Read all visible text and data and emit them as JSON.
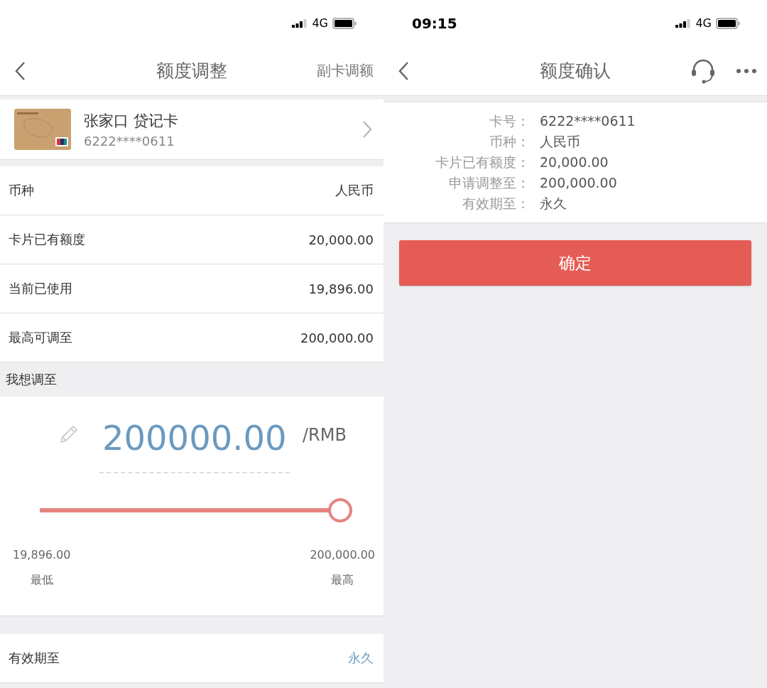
{
  "left": {
    "status": {
      "network": "4G"
    },
    "nav": {
      "title": "额度调整",
      "action": "副卡调额"
    },
    "card": {
      "name": "张家口 贷记卡",
      "number": "6222****0611"
    },
    "rows": [
      {
        "label": "币种",
        "value": "人民币"
      },
      {
        "label": "卡片已有额度",
        "value": "20,000.00"
      },
      {
        "label": "当前已使用",
        "value": "19,896.00"
      },
      {
        "label": "最高可调至",
        "value": "200,000.00"
      }
    ],
    "section_title": "我想调至",
    "amount": {
      "value": "200000.00",
      "unit": "/RMB"
    },
    "slider": {
      "level": 1,
      "min_value": "19,896.00",
      "min_label": "最低",
      "max_value": "200,000.00",
      "max_label": "最高"
    },
    "validity": {
      "label": "有效期至",
      "value": "永久"
    }
  },
  "right": {
    "status": {
      "time": "09:15",
      "network": "4G"
    },
    "nav": {
      "title": "额度确认"
    },
    "details": [
      {
        "label": "卡号：",
        "value": "6222****0611"
      },
      {
        "label": "币种：",
        "value": "人民币"
      },
      {
        "label": "卡片已有额度：",
        "value": "20,000.00"
      },
      {
        "label": "申请调整至：",
        "value": "200,000.00"
      },
      {
        "label": "有效期至：",
        "value": "永久"
      }
    ],
    "button": "确定"
  }
}
